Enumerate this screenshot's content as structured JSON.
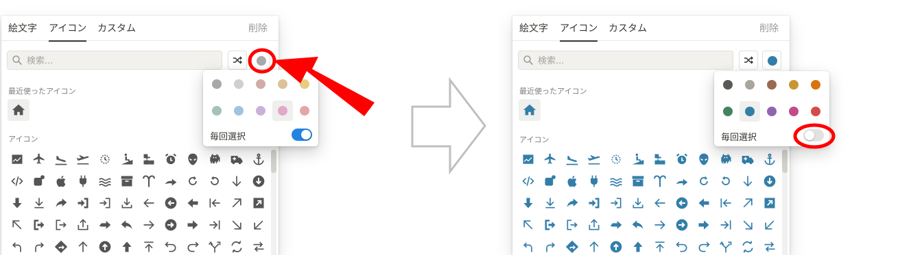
{
  "tabs": [
    {
      "label": "絵文字"
    },
    {
      "label": "アイコン"
    },
    {
      "label": "カスタム"
    }
  ],
  "remove_label": "削除",
  "search": {
    "placeholder": "検索..."
  },
  "recent_label": "最近使ったアイコン",
  "icons_label": "アイコン",
  "every_time_label": "毎回選択",
  "left": {
    "icon_color": "#555555",
    "current_color_dot": "#aaaaaa",
    "toggle_on": true,
    "toggle_on_color": "#2383e2",
    "selected_swatch_index": 8,
    "colors": [
      "#a8a8a8",
      "#cfcfcb",
      "#cfaca7",
      "#ddc197",
      "#e8cc81",
      "#a4c3b4",
      "#a3c2dc",
      "#c7b2dc",
      "#e2a8c9",
      "#e6a6a6"
    ]
  },
  "right": {
    "icon_color": "#337ea9",
    "current_color_dot": "#337ea9",
    "toggle_on": false,
    "toggle_off_color": "#e3e2e0",
    "selected_swatch_index": 6,
    "colors": [
      "#5a5955",
      "#a8a59f",
      "#9a6a54",
      "#cb9433",
      "#d9730d",
      "#448361",
      "#337ea9",
      "#9065b0",
      "#c14c8a",
      "#d44c47"
    ]
  },
  "icon_names": [
    "chart-area-icon",
    "airplane-icon",
    "airplane-landing-icon",
    "airplane-takeoff-icon",
    "alarm-sparkle-icon",
    "wheelchair-ramp-icon",
    "puzzle-icon",
    "alarm-clock-icon",
    "alien-icon",
    "space-invader-icon",
    "ambulance-icon",
    "anchor-icon",
    "code-tags-icon",
    "android-notification-icon",
    "apple-icon",
    "plug-icon",
    "water-waves-icon",
    "archive-icon",
    "aries-icon",
    "curved-arrow-right-icon",
    "redo-icon",
    "undo-icon",
    "arrow-down-icon",
    "arrow-down-circle-icon",
    "arrow-down-bold-icon",
    "arrow-down-to-line-icon",
    "share-arrow-icon",
    "enter-bold-icon",
    "enter-icon",
    "download-icon",
    "arrow-left-icon",
    "arrow-left-circle-icon",
    "arrow-left-bold-icon",
    "arrow-left-to-line-icon",
    "arrow-up-right-icon",
    "arrow-up-right-box-icon",
    "arrow-up-left-icon",
    "exit-bold-icon",
    "exit-icon",
    "upload-box-icon",
    "right-bold-arrow-icon",
    "reply-icon",
    "arrow-right-icon",
    "arrow-right-circle-icon",
    "arrow-right-bold-icon",
    "arrow-right-to-line-icon",
    "arrow-down-right-icon",
    "arrow-down-left-icon",
    "turn-left-icon",
    "turn-right-icon",
    "direction-diamond-icon",
    "arrow-up-icon",
    "arrow-up-circle-icon",
    "arrow-up-bold-icon",
    "arrow-up-to-line-icon",
    "u-turn-left-icon",
    "u-turn-right-icon",
    "merge-icon",
    "repeat-icon",
    "swap-icon"
  ]
}
